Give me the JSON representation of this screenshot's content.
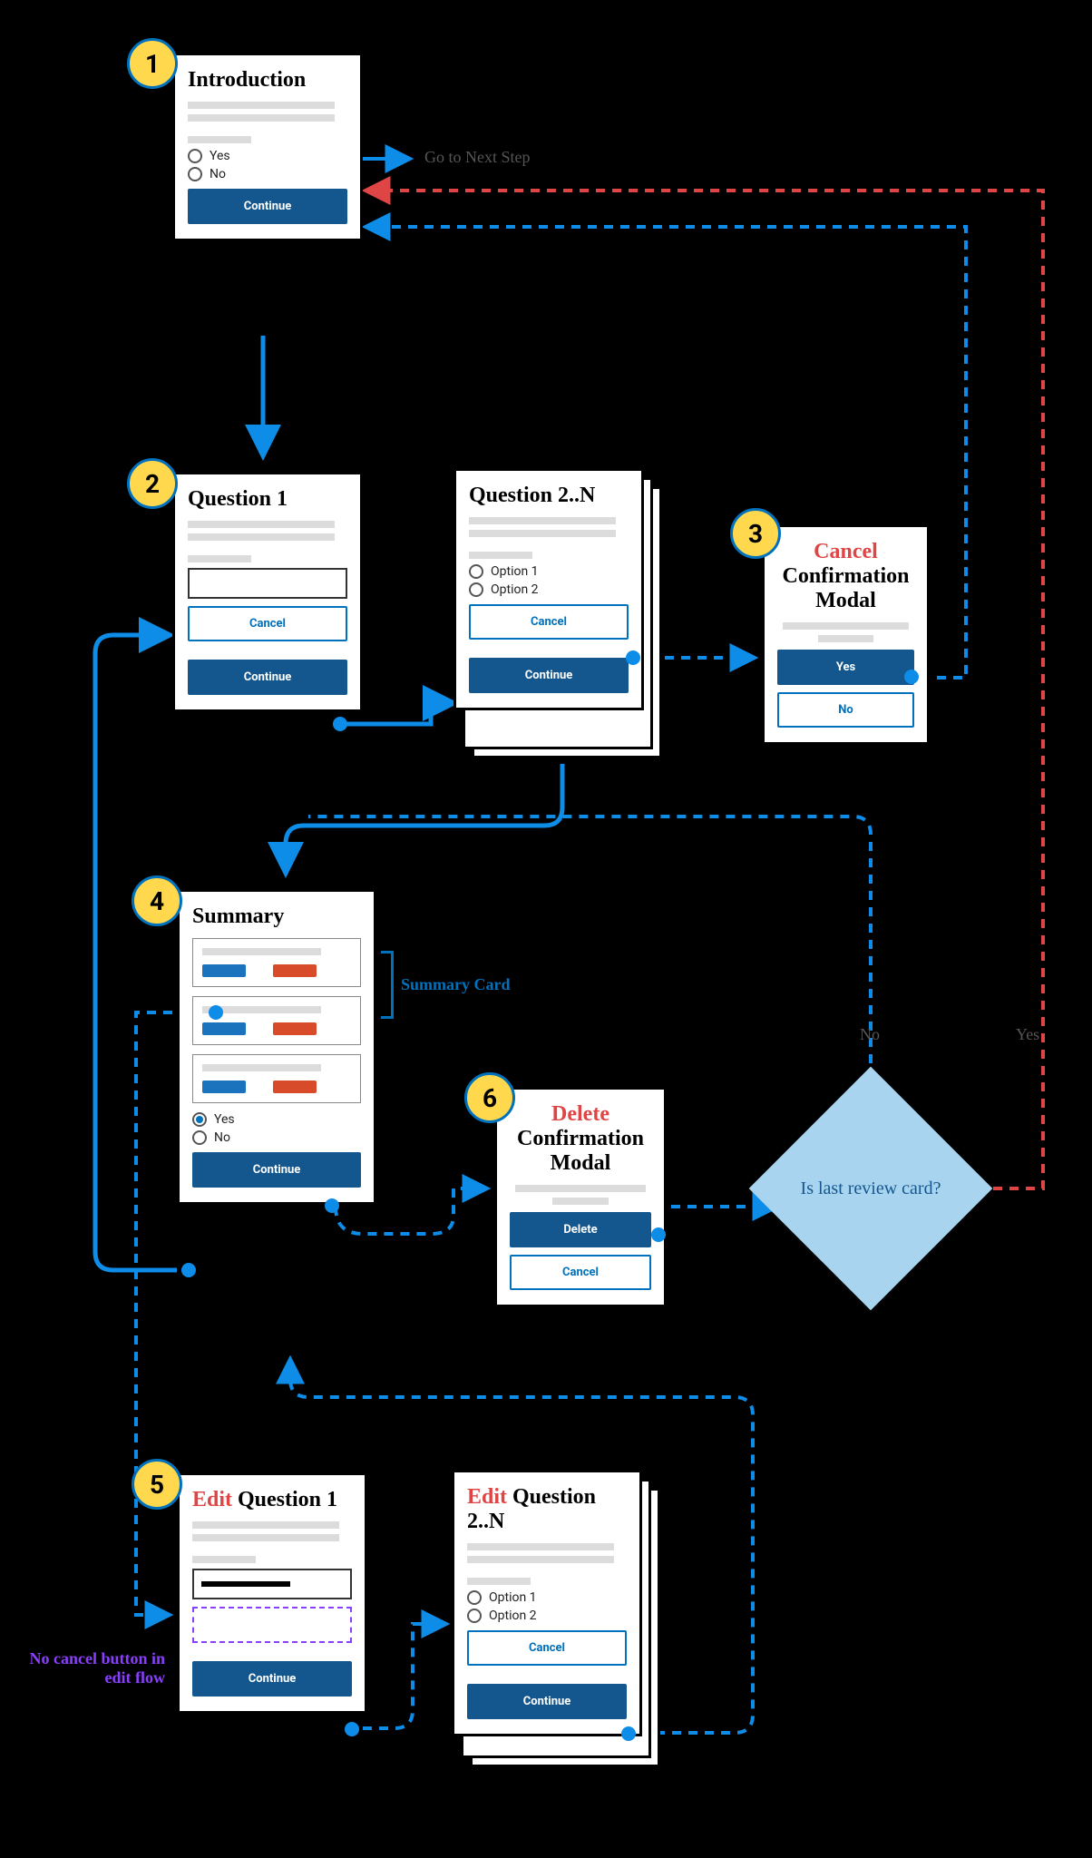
{
  "legend": {
    "go_next": "Go to Next Step"
  },
  "steps": {
    "1": {
      "num": "1",
      "title": "Introduction",
      "opt_yes": "Yes",
      "opt_no": "No",
      "continue": "Continue"
    },
    "2": {
      "num": "2",
      "title": "Question 1",
      "cancel": "Cancel",
      "continue": "Continue"
    },
    "2b": {
      "title": "Question 2..N",
      "opt1": "Option 1",
      "opt2": "Option 2",
      "cancel": "Cancel",
      "continue": "Continue"
    },
    "3": {
      "num": "3",
      "title_red": "Cancel",
      "title_rest": "Confirmation Modal",
      "yes": "Yes",
      "no": "No"
    },
    "4": {
      "num": "4",
      "title": "Summary",
      "opt_yes": "Yes",
      "opt_no": "No",
      "continue": "Continue",
      "summary_card_label": "Summary Card"
    },
    "5": {
      "num": "5",
      "title_red": "Edit",
      "title_rest": " Question 1",
      "continue": "Continue",
      "note": "No cancel button in edit flow"
    },
    "5b": {
      "title_red": "Edit",
      "title_rest": " Question 2..N",
      "opt1": "Option 1",
      "opt2": "Option 2",
      "cancel": "Cancel",
      "continue": "Continue"
    },
    "6": {
      "num": "6",
      "title_red": "Delete",
      "title_rest": "Confirmation Modal",
      "delete": "Delete",
      "cancel": "Cancel"
    }
  },
  "decision": {
    "text": "Is last review card?",
    "no": "No",
    "yes": "Yes"
  }
}
